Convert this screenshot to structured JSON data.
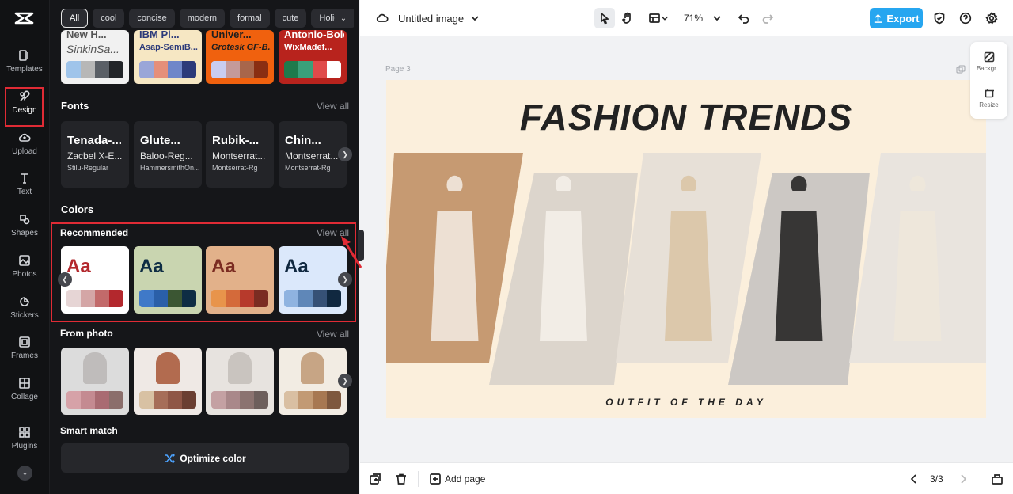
{
  "rail": {
    "items": [
      {
        "label": "Templates",
        "icon": "templates-icon"
      },
      {
        "label": "Design",
        "icon": "design-icon"
      },
      {
        "label": "Upload",
        "icon": "upload-icon"
      },
      {
        "label": "Text",
        "icon": "text-icon"
      },
      {
        "label": "Shapes",
        "icon": "shapes-icon"
      },
      {
        "label": "Photos",
        "icon": "photos-icon"
      },
      {
        "label": "Stickers",
        "icon": "stickers-icon"
      },
      {
        "label": "Frames",
        "icon": "frames-icon"
      },
      {
        "label": "Collage",
        "icon": "collage-icon"
      },
      {
        "label": "Plugins",
        "icon": "plugins-icon"
      }
    ],
    "active": "Design"
  },
  "panel": {
    "chips": [
      "All",
      "cool",
      "concise",
      "modern",
      "formal",
      "cute",
      "Holiday"
    ],
    "selected_chip": "All",
    "top_cards": [
      {
        "line1": "New H...",
        "line2": "SinkinSa...",
        "bg": "#f1f1f1",
        "text_color": "#555",
        "swatches": [
          "#9fc4ea",
          "#b7b7b7",
          "#5a5f66",
          "#222428"
        ]
      },
      {
        "line1": "IBM Pl...",
        "line2": "Asap-SemiB...",
        "bg": "#f6e7c3",
        "text_color": "#2c3a7a",
        "swatches": [
          "#9aa6d8",
          "#e58f7a",
          "#6f86c9",
          "#2c3a7a"
        ]
      },
      {
        "line1": "Univer...",
        "line2": "Grotesk GF-B...",
        "bg": "#f0610e",
        "text_color": "#1e1e1e",
        "swatches": [
          "#c9cdf0",
          "#c49a9a",
          "#a8664b",
          "#8a2e12"
        ]
      },
      {
        "line1": "Antonio-Bold",
        "line2": "WixMadef...",
        "bg": "#b8231d",
        "text_color": "#ffffff",
        "swatches": [
          "#1e7a4c",
          "#3aa07a",
          "#e04a4a",
          "#ffffff"
        ]
      }
    ],
    "fonts": {
      "title": "Fonts",
      "view_all": "View all",
      "cards": [
        {
          "heading": "Tenada-...",
          "sub": "Zacbel X-E...",
          "caption": "Stilu-Regular"
        },
        {
          "heading": "Glute...",
          "sub": "Baloo-Reg...",
          "caption": "HammersmithOn..."
        },
        {
          "heading": "Rubik-...",
          "sub": "Montserrat...",
          "caption": "Montserrat-Rg"
        },
        {
          "heading": "Chin...",
          "sub": "Montserrat...",
          "caption": "Montserrat-Rg"
        }
      ]
    },
    "colors_title": "Colors",
    "recommended": {
      "title": "Recommended",
      "view_all": "View all",
      "cards": [
        {
          "sample": "Aa",
          "bg": "#ffffff",
          "text_color": "#b3282d",
          "swatches": [
            "#e6d5d5",
            "#d4a6a6",
            "#c26a6a",
            "#b3282d"
          ]
        },
        {
          "sample": "Aa",
          "bg": "#c9d5b0",
          "text_color": "#0e2d44",
          "swatches": [
            "#3f79c8",
            "#2a5fa8",
            "#3b5633",
            "#0e2d44"
          ]
        },
        {
          "sample": "Aa",
          "bg": "#e2b18a",
          "text_color": "#7b2c22",
          "swatches": [
            "#e8944b",
            "#d46a3a",
            "#b73a2c",
            "#7b2c22"
          ]
        },
        {
          "sample": "Aa",
          "bg": "#dbe8fb",
          "text_color": "#102840",
          "swatches": [
            "#8fb3e0",
            "#5f87b8",
            "#365176",
            "#102840"
          ]
        }
      ]
    },
    "from_photo": {
      "title": "From photo",
      "view_all": "View all",
      "cards": [
        {
          "photo": [
            "#dcdcdc",
            "#bfbcbb"
          ],
          "swatches": [
            "#d6a2a8",
            "#c48a91",
            "#a96b72",
            "#8b6e6b"
          ]
        },
        {
          "photo": [
            "#efe9e5",
            "#b26b4f"
          ],
          "swatches": [
            "#d8c1a3",
            "#a66d58",
            "#8f5646",
            "#6b3f32"
          ]
        },
        {
          "photo": [
            "#e7e3df",
            "#c9c4bf"
          ],
          "swatches": [
            "#c4a1a3",
            "#a9888a",
            "#8b7370",
            "#6d5f5c"
          ]
        },
        {
          "photo": [
            "#f2ece3",
            "#c7a585"
          ],
          "swatches": [
            "#d9bfa2",
            "#c29a74",
            "#a77852",
            "#7e583e"
          ]
        }
      ]
    },
    "smart_match": {
      "title": "Smart match",
      "button": "Optimize color"
    }
  },
  "topbar": {
    "title": "Untitled image",
    "zoom": "71%",
    "export": "Export"
  },
  "canvas": {
    "page_label": "Page 3",
    "headline": "FASHION TRENDS",
    "subline": "OUTFIT OF THE DAY",
    "side_tools": [
      {
        "label": "Backgr...",
        "icon": "background-icon"
      },
      {
        "label": "Resize",
        "icon": "resize-icon"
      }
    ],
    "photo_colors": [
      [
        "#c69a72",
        "#f3ece4"
      ],
      [
        "#dcd5cc",
        "#f6f1ea"
      ],
      [
        "#e7e0d7",
        "#d9c3a3"
      ],
      [
        "#ccc8c4",
        "#1c1c1c"
      ],
      [
        "#e9e4de",
        "#efe7da"
      ]
    ]
  },
  "bottombar": {
    "add_page": "Add page",
    "page_count": "3/3"
  },
  "colors": {
    "accent": "#26a6f0",
    "highlight": "#e02b35",
    "panel_bg": "#151619"
  }
}
